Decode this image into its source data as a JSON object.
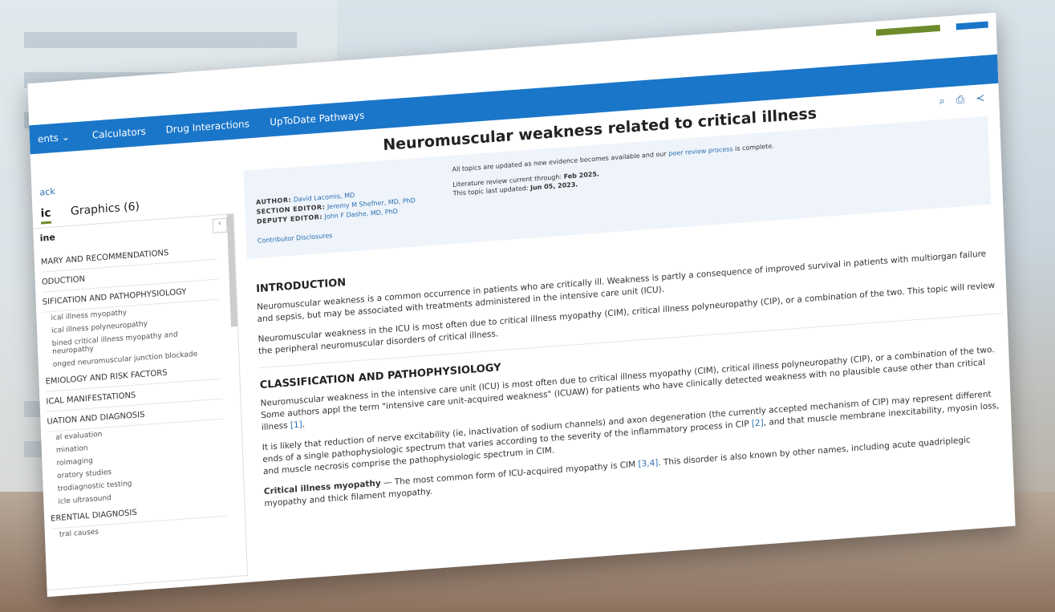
{
  "nav": {
    "items": [
      "ents ⌄",
      "Calculators",
      "Drug Interactions",
      "UpToDate Pathways"
    ]
  },
  "article": {
    "title": "Neuromuscular weakness related to critical illness"
  },
  "back_link": "ack",
  "tabs": {
    "topic": "ic",
    "graphics": "Graphics (6)"
  },
  "sidebar": {
    "outline_label": "ine",
    "items": [
      {
        "kind": "h",
        "text": "MARY AND RECOMMENDATIONS"
      },
      {
        "kind": "h",
        "text": "ODUCTION"
      },
      {
        "kind": "h",
        "text": "SIFICATION AND PATHOPHYSIOLOGY"
      },
      {
        "kind": "s",
        "text": "ical illness myopathy"
      },
      {
        "kind": "s",
        "text": "ical illness polyneuropathy"
      },
      {
        "kind": "s",
        "text": "bined critical illness myopathy and neuropathy"
      },
      {
        "kind": "s",
        "text": "onged neuromuscular junction blockade"
      },
      {
        "kind": "h",
        "text": "EMIOLOGY AND RISK FACTORS"
      },
      {
        "kind": "h",
        "text": "ICAL MANIFESTATIONS"
      },
      {
        "kind": "h",
        "text": "UATION AND DIAGNOSIS"
      },
      {
        "kind": "s",
        "text": "al evaluation"
      },
      {
        "kind": "s",
        "text": "mination"
      },
      {
        "kind": "s",
        "text": "roimaging"
      },
      {
        "kind": "s",
        "text": "oratory studies"
      },
      {
        "kind": "s",
        "text": "trodiagnostic testing"
      },
      {
        "kind": "s",
        "text": "icle ultrasound"
      },
      {
        "kind": "h",
        "text": "ERENTIAL DIAGNOSIS"
      },
      {
        "kind": "s",
        "text": "tral causes"
      }
    ]
  },
  "meta": {
    "author_label": "AUTHOR:",
    "author": "David Lacomis, MD",
    "section_label": "SECTION EDITOR:",
    "section_editor": "Jeremy M Shefner, MD, PhD",
    "deputy_label": "DEPUTY EDITOR:",
    "deputy_editor": "John F Dashe, MD, PhD",
    "disclosures": "Contributor Disclosures",
    "updated_note_pre": "All topics are updated as new evidence becomes available and our ",
    "updated_note_link": "peer review process",
    "updated_note_post": " is complete.",
    "review_pre": "Literature review current through: ",
    "review_date": "Feb 2025.",
    "updated_pre": "This topic last updated: ",
    "updated_date": "Jun 05, 2023."
  },
  "content": {
    "intro_heading": "INTRODUCTION",
    "intro_p1": "Neuromuscular weakness is a common occurrence in patients who are critically ill. Weakness is partly a consequence of improved survival in patients with multiorgan failure and sepsis, but may be associated with treatments administered in the intensive care unit (ICU).",
    "intro_p2": "Neuromuscular weakness in the ICU is most often due to critical illness myopathy (CIM), critical illness polyneuropathy (CIP), or a combination of the two. This topic will review the peripheral neuromuscular disorders of critical illness.",
    "class_heading": "CLASSIFICATION AND PATHOPHYSIOLOGY",
    "class_p1_a": "Neuromuscular weakness in the intensive care unit (ICU) is most often due to critical illness myopathy (CIM), critical illness polyneuropathy (CIP), or a combination of the two. Some authors appl the term \"intensive care unit-acquired weakness\" (ICUAW) for patients who have clinically detected weakness with no plausible cause other than critical illness ",
    "class_p1_ref": "[1]",
    "class_p2_a": "It is likely that reduction of nerve excitability (ie, inactivation of sodium channels) and axon degeneration (the currently accepted mechanism of CIP) may represent different ends of a single pathophysiologic spectrum that varies according to the severity of the inflammatory process in CIP ",
    "class_p2_ref": "[2]",
    "class_p2_b": ", and that muscle membrane inexcitability, myosin loss, and muscle necrosis comprise the pathophysiologic spectrum in CIM.",
    "cim_label": "Critical illness myopathy",
    "cim_text_a": " — The most common form of ICU-acquired myopathy is CIM ",
    "cim_ref": "[3,4]",
    "cim_text_b": ". This disorder is also known by other names, including acute quadriplegic myopathy and thick filament myopathy."
  }
}
